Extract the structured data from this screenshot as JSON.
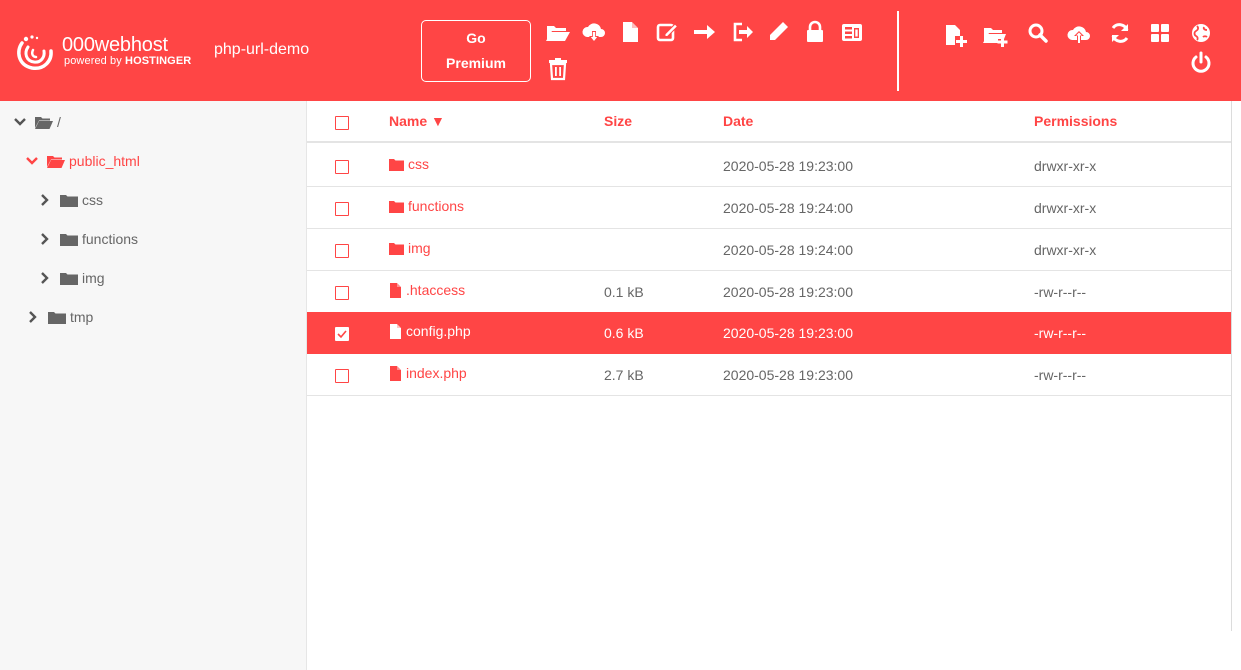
{
  "header": {
    "brand_name": "000webhost",
    "brand_sub_prefix": "powered by ",
    "brand_sub_company": "HOSTINGER",
    "site_name": "php-url-demo",
    "premium_line1": "Go",
    "premium_line2": "Premium",
    "toolbar_icons": [
      "open-folder-icon",
      "cloud-download-icon",
      "file-icon",
      "edit-icon",
      "move-arrow-icon",
      "logout-icon",
      "pencil-icon",
      "lock-icon",
      "archive-icon",
      "trash-icon"
    ],
    "right_icons": [
      "new-file-icon",
      "new-folder-icon",
      "search-icon",
      "upload-icon",
      "refresh-icon",
      "grid-icon",
      "globe-icon",
      "power-icon"
    ],
    "accent": "#ff4545"
  },
  "tree": {
    "root_label": "/",
    "items": [
      {
        "label": "public_html",
        "active": true
      },
      {
        "label": "css"
      },
      {
        "label": "functions"
      },
      {
        "label": "img"
      },
      {
        "label": "tmp"
      }
    ]
  },
  "table": {
    "headers": {
      "name": "Name ▼",
      "size": "Size",
      "date": "Date",
      "permissions": "Permissions"
    },
    "rows": [
      {
        "type": "folder",
        "name": "css",
        "size": "",
        "date": "2020-05-28 19:23:00",
        "permissions": "drwxr-xr-x",
        "selected": false
      },
      {
        "type": "folder",
        "name": "functions",
        "size": "",
        "date": "2020-05-28 19:24:00",
        "permissions": "drwxr-xr-x",
        "selected": false
      },
      {
        "type": "folder",
        "name": "img",
        "size": "",
        "date": "2020-05-28 19:24:00",
        "permissions": "drwxr-xr-x",
        "selected": false
      },
      {
        "type": "file",
        "name": ".htaccess",
        "size": "0.1 kB",
        "date": "2020-05-28 19:23:00",
        "permissions": "-rw-r--r--",
        "selected": false
      },
      {
        "type": "file",
        "name": "config.php",
        "size": "0.6 kB",
        "date": "2020-05-28 19:23:00",
        "permissions": "-rw-r--r--",
        "selected": true
      },
      {
        "type": "file",
        "name": "index.php",
        "size": "2.7 kB",
        "date": "2020-05-28 19:23:00",
        "permissions": "-rw-r--r--",
        "selected": false
      }
    ]
  }
}
